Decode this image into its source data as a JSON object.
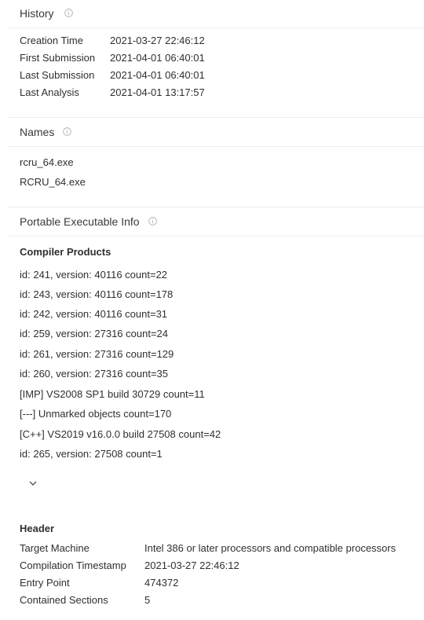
{
  "history": {
    "title": "History",
    "rows": [
      {
        "label": "Creation Time",
        "value": "2021-03-27 22:46:12"
      },
      {
        "label": "First Submission",
        "value": "2021-04-01 06:40:01"
      },
      {
        "label": "Last Submission",
        "value": "2021-04-01 06:40:01"
      },
      {
        "label": "Last Analysis",
        "value": "2021-04-01 13:17:57"
      }
    ]
  },
  "names": {
    "title": "Names",
    "items": [
      "rcru_64.exe",
      "RCRU_64.exe"
    ]
  },
  "pe_info": {
    "title": "Portable Executable Info",
    "compiler_products": {
      "title": "Compiler Products",
      "items": [
        "id: 241, version: 40116 count=22",
        "id: 243, version: 40116 count=178",
        "id: 242, version: 40116 count=31",
        "id: 259, version: 27316 count=24",
        "id: 261, version: 27316 count=129",
        "id: 260, version: 27316 count=35",
        "[IMP] VS2008 SP1 build 30729 count=11",
        "[---] Unmarked objects count=170",
        "[C++] VS2019 v16.0.0 build 27508 count=42",
        "id: 265, version: 27508 count=1"
      ]
    },
    "header": {
      "title": "Header",
      "rows": [
        {
          "label": "Target Machine",
          "value": "Intel 386 or later processors and compatible processors"
        },
        {
          "label": "Compilation Timestamp",
          "value": "2021-03-27 22:46:12"
        },
        {
          "label": "Entry Point",
          "value": "474372"
        },
        {
          "label": "Contained Sections",
          "value": "5"
        }
      ]
    }
  },
  "icons": {
    "info": "info-icon",
    "expand": "chevron-down-icon"
  },
  "colors": {
    "text": "#2f2f2f",
    "muted_icon": "#b5b5b5",
    "divider": "#ececec"
  }
}
